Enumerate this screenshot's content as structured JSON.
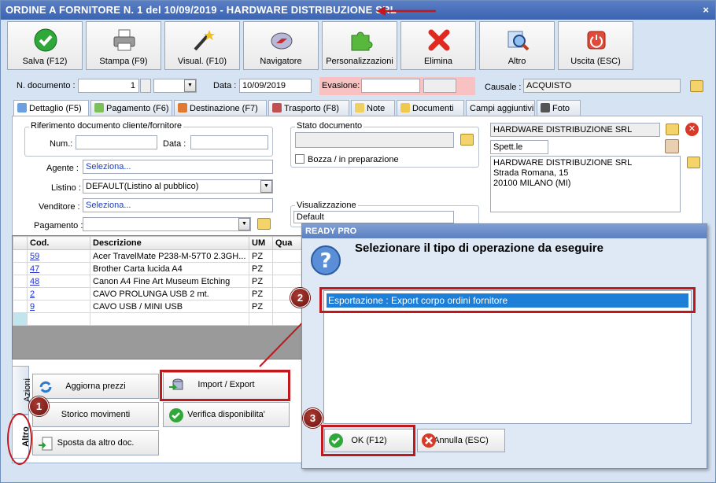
{
  "window": {
    "title": "ORDINE A FORNITORE N. 1 del 10/09/2019 - HARDWARE DISTRIBUZIONE SRL",
    "close": "×"
  },
  "toolbar": [
    {
      "label": "Salva (F12)",
      "icon": "check-icon"
    },
    {
      "label": "Stampa (F9)",
      "icon": "printer-icon"
    },
    {
      "label": "Visual. (F10)",
      "icon": "magic-wand-icon"
    },
    {
      "label": "Navigatore",
      "icon": "compass-icon"
    },
    {
      "label": "Personalizzazioni",
      "icon": "puzzle-icon"
    },
    {
      "label": "Elimina",
      "icon": "red-x-icon"
    },
    {
      "label": "Altro",
      "icon": "magnifier-icon"
    },
    {
      "label": "Uscita (ESC)",
      "icon": "power-icon"
    }
  ],
  "header": {
    "ndoc_label": "N. documento :",
    "ndoc_value": "1",
    "data_label": "Data :",
    "data_value": "10/09/2019",
    "evasione_label": "Evasione:",
    "causale_label": "Causale :",
    "causale_value": "ACQUISTO"
  },
  "tabs": [
    "Dettaglio (F5)",
    "Pagamento (F6)",
    "Destinazione (F7)",
    "Trasporto (F8)",
    "Note",
    "Documenti",
    "Campi aggiuntivi",
    "Foto"
  ],
  "detail": {
    "rif_title": "Riferimento documento cliente/fornitore",
    "num_label": "Num.:",
    "data_label": "Data :",
    "agente_label": "Agente :",
    "agente_value": "Seleziona...",
    "listino_label": "Listino :",
    "listino_value": "DEFAULT(Listino al pubblico)",
    "venditore_label": "Venditore :",
    "venditore_value": "Seleziona...",
    "pagamento_label": "Pagamento :",
    "stato_title": "Stato documento",
    "bozza_label": "Bozza / in preparazione",
    "visual_title": "Visualizzazione",
    "visual_value": "Default",
    "supplier_name": "HARDWARE DISTRIBUZIONE SRL",
    "spett": "Spett.le",
    "address": [
      "HARDWARE DISTRIBUZIONE SRL",
      "Strada Romana, 15",
      "20100 MILANO (MI)"
    ]
  },
  "grid": {
    "columns": [
      "Cod.",
      "Descrizione",
      "UM",
      "Qua"
    ],
    "rows": [
      {
        "cod": "59",
        "desc": "Acer TravelMate P238-M-57T0 2.3GH...",
        "um": "PZ"
      },
      {
        "cod": "47",
        "desc": "Brother Carta lucida A4",
        "um": "PZ"
      },
      {
        "cod": "48",
        "desc": "Canon A4 Fine Art Museum Etching",
        "um": "PZ"
      },
      {
        "cod": "2",
        "desc": "CAVO PROLUNGA USB 2 mt.",
        "um": "PZ"
      },
      {
        "cod": "9",
        "desc": "CAVO USB / MINI USB",
        "um": "PZ"
      }
    ]
  },
  "side_tabs": [
    "Azioni",
    "Altro"
  ],
  "actions": {
    "aggiorna": "Aggiorna prezzi",
    "import": "Import / Export",
    "storico": "Storico movimenti",
    "verifica": "Verifica disponibilita'",
    "sposta": "Sposta da altro doc."
  },
  "dialog": {
    "title": "READY PRO",
    "question": "Selezionare il tipo di operazione da eseguire",
    "option": "Esportazione : Export corpo ordini fornitore",
    "ok": "OK (F12)",
    "cancel": "Annulla (ESC)"
  },
  "badges": [
    "1",
    "2",
    "3"
  ],
  "colors": {
    "annotation_red": "#c0181c",
    "title_blue": "#3b63b0",
    "selection_blue": "#1e7fd8"
  }
}
